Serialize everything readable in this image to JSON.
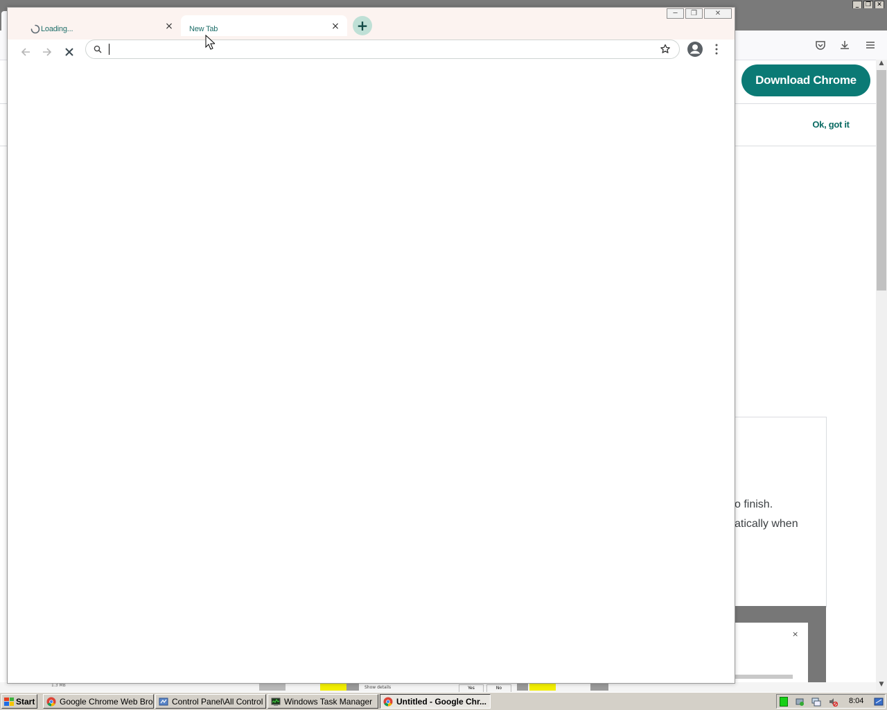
{
  "background_window": {
    "download_button_label": "Download Chrome",
    "ok_got_it_label": "Ok, got it",
    "card_text_line1": "o finish.",
    "card_text_line2": "atically when",
    "dialog_close": "×",
    "bottom_strip_size": "1.3 MB",
    "bottom_strip_show_details": "Show details",
    "bottom_strip_yes": "Yes",
    "bottom_strip_no": "No"
  },
  "chrome": {
    "tabs": [
      {
        "label": "Loading...",
        "close": "×"
      },
      {
        "label": "New Tab",
        "close": "×"
      }
    ],
    "new_tab_symbol": "+",
    "omnibox": {
      "value": "",
      "placeholder": ""
    },
    "window_buttons": {
      "minimize": "─",
      "restore": "❐",
      "close": "✕"
    }
  },
  "taskbar": {
    "start_label": "Start",
    "tasks": [
      {
        "label": "Google Chrome Web Bro..."
      },
      {
        "label": "Control Panel\\All Control ..."
      },
      {
        "label": "Windows Task Manager"
      },
      {
        "label": "Untitled - Google Chr..."
      }
    ],
    "clock": "8:04"
  },
  "colors": {
    "accent_teal": "#0b7a75",
    "tab_strip_bg": "#fcf3f0",
    "new_tab_button_bg": "#bfe0d6"
  }
}
